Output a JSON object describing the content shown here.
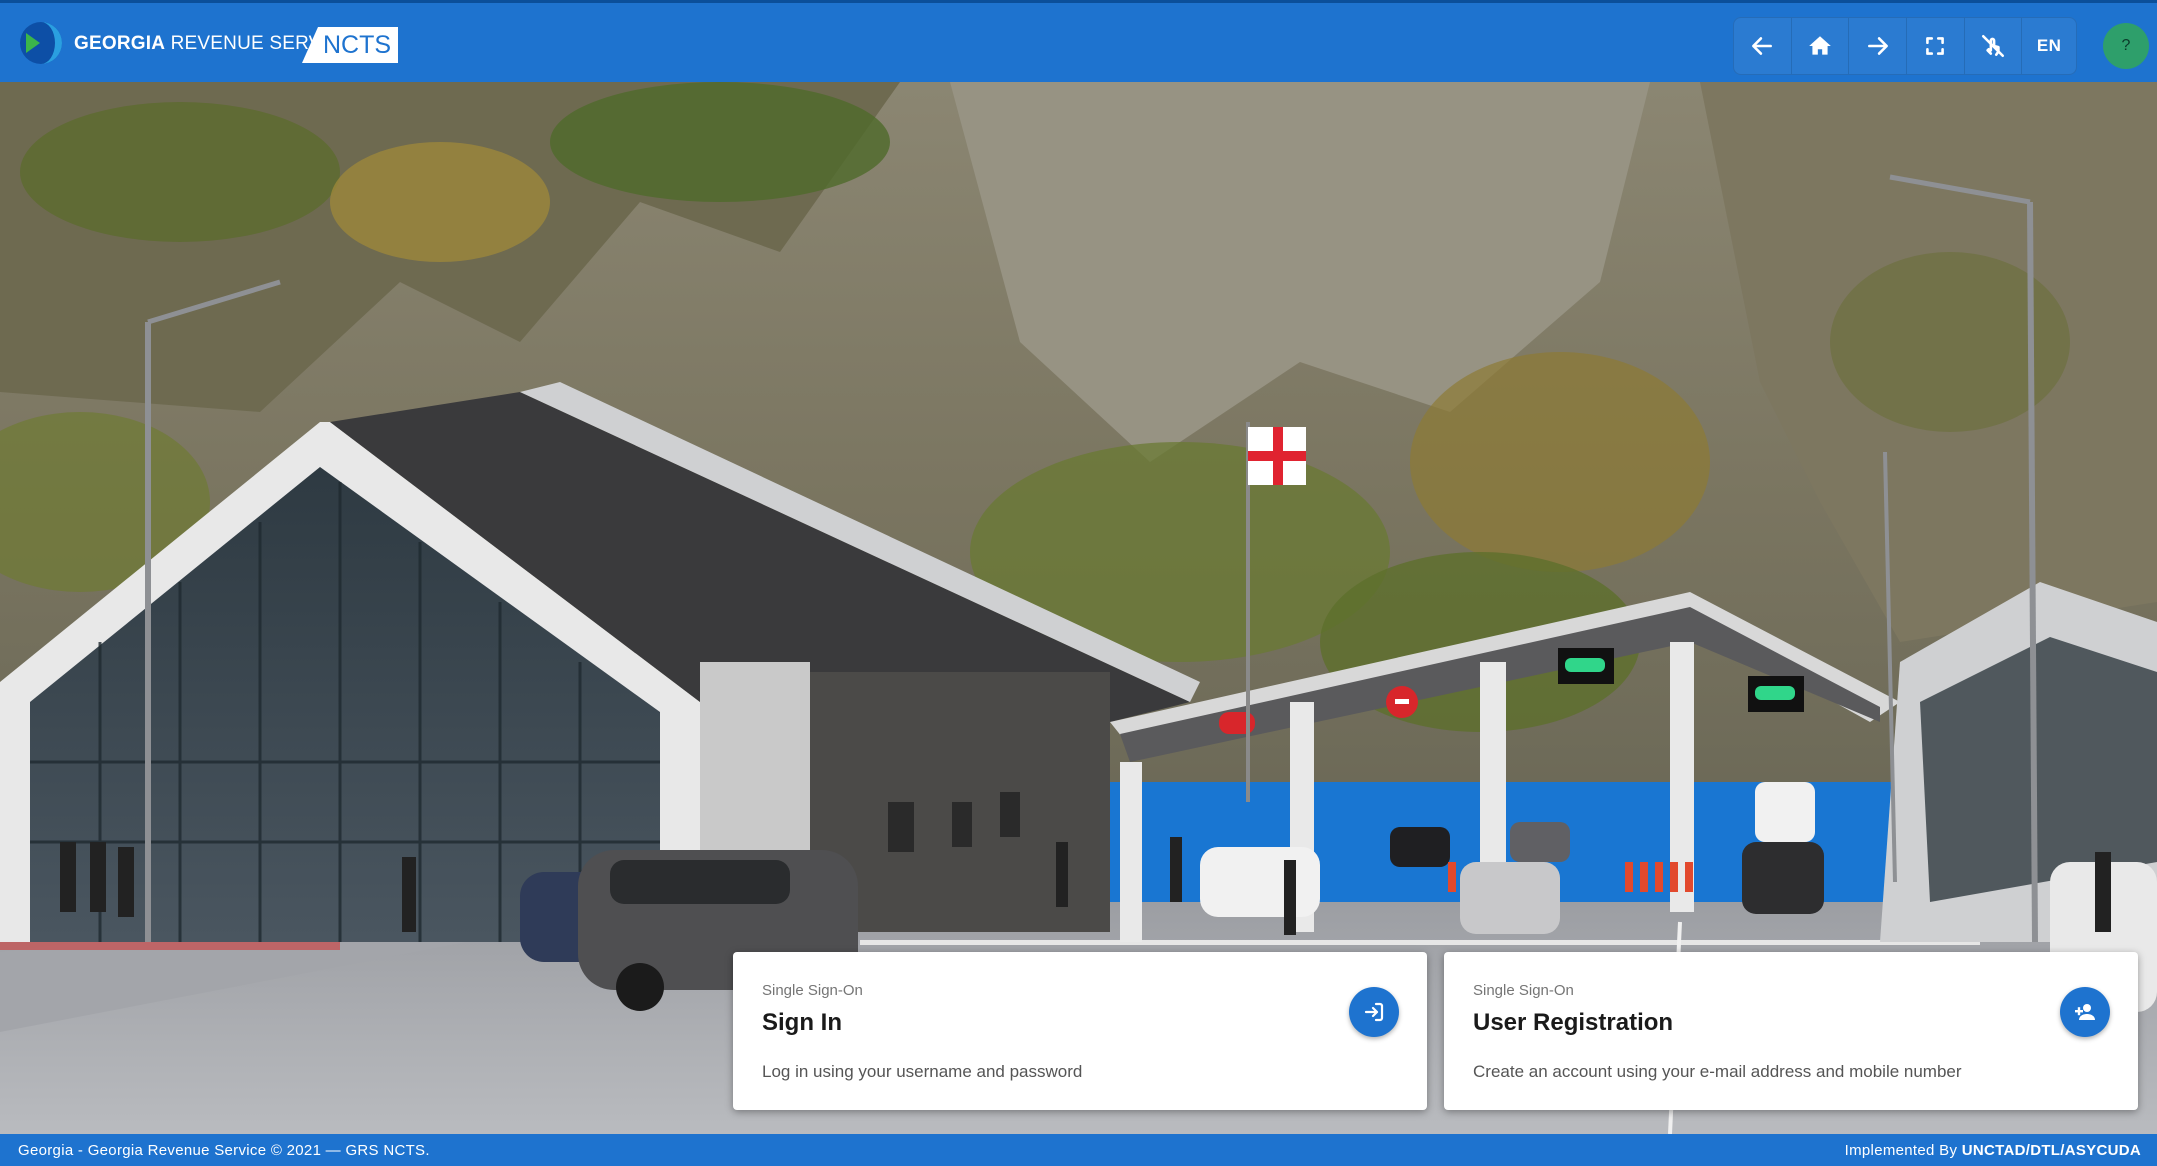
{
  "header": {
    "brand_bold": "GEORGIA",
    "brand_rest": "REVENUE SERVICE",
    "brand_tag": "NCTS",
    "language": "EN",
    "help": "?",
    "toolbar_icons": [
      "arrow-left-icon",
      "home-icon",
      "arrow-right-icon",
      "fullscreen-icon",
      "touch-off-icon"
    ]
  },
  "cards": [
    {
      "overline": "Single Sign-On",
      "title": "Sign In",
      "description": "Log in using your username and password",
      "icon": "login-icon"
    },
    {
      "overline": "Single Sign-On",
      "title": "User Registration",
      "description": "Create an account using your e-mail address and mobile number",
      "icon": "person-add-icon"
    }
  ],
  "footer": {
    "left": "Georgia - Georgia Revenue Service © 2021 — GRS NCTS.",
    "right_prefix": "Implemented By",
    "right_strong": "UNCTAD/DTL/ASYCUDA"
  },
  "colors": {
    "primary": "#1e73cf",
    "help_avatar": "#2e9f6b",
    "card_bg": "#ffffff"
  }
}
